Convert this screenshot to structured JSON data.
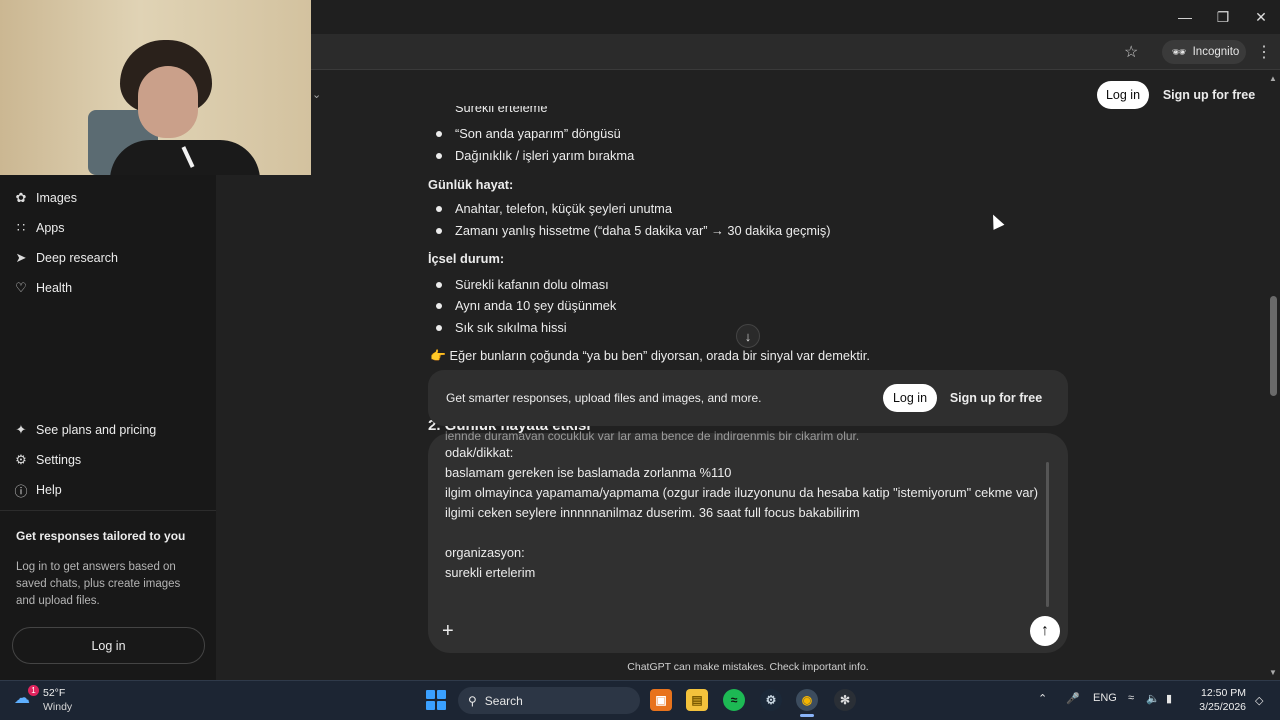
{
  "browser": {
    "incognito_label": "Incognito",
    "window_controls": [
      "minimize-icon",
      "restore-icon",
      "close-icon"
    ]
  },
  "header": {
    "login_label": "Log in",
    "signup_label": "Sign up for free"
  },
  "sidebar": {
    "items": [
      {
        "label": "Images",
        "icon": "images-icon"
      },
      {
        "label": "Apps",
        "icon": "apps-icon"
      },
      {
        "label": "Deep research",
        "icon": "telescope-icon"
      },
      {
        "label": "Health",
        "icon": "heart-icon"
      }
    ],
    "bottom_items": [
      {
        "label": "See plans and pricing",
        "icon": "plans-icon"
      },
      {
        "label": "Settings",
        "icon": "gear-icon"
      },
      {
        "label": "Help",
        "icon": "help-icon"
      }
    ],
    "promo_title": "Get responses tailored to you",
    "promo_text": "Log in to get answers based on saved chats, plus create images and upload files.",
    "login_label": "Log in"
  },
  "chat": {
    "cut_top_line": "Sürekli erteleme",
    "list1": [
      "“Son anda yaparım” döngüsü",
      "Dağınıklık / işleri yarım bırakma"
    ],
    "heading_daily": "Günlük hayat:",
    "list2": [
      "Anahtar, telefon, küçük şeyleri unutma",
      "Zamanı yanlış hissetme (“daha 5 dakika var” → 30 dakika geçmiş)"
    ],
    "heading_inner": "İçsel durum:",
    "list3": [
      "Sürekli kafanın dolu olması",
      "Aynı anda 10 şey düşünmek",
      "Sık sık sıkılma hissi"
    ],
    "conclusion": "👉 Eğer bunların çoğunda “ya bu ben” diyorsan, orada bir sinyal var demektir.",
    "section2": "2. Günlük hayata etkisi"
  },
  "banner": {
    "text": "Get smarter responses, upload files and images, and more.",
    "login_label": "Log in",
    "signup_label": "Sign up for free"
  },
  "composer": {
    "ghost_line": "iennde duramayan cocukluk var lar ama bence de indirgenmis bir cikarim olur.",
    "text": "odak/dikkat:\nbaslamam gereken ise baslamada zorlanma %110\nilgim olmayinca yapamama/yapmama (ozgur irade iluzyonunu da hesaba katip \"istemiyorum\" cekme var)\nilgimi ceken seylere innnnnanilmaz duserim. 36 saat full focus bakabilirim\n\norganizasyon:\nsurekli ertelerim",
    "disclaimer": "ChatGPT can make mistakes. Check important info."
  },
  "taskbar": {
    "weather_temp": "52°F",
    "weather_cond": "Windy",
    "weather_badge": "1",
    "search_label": "Search",
    "language": "ENG",
    "time": "12:50 PM",
    "date": "3/25/2026"
  },
  "colors": {
    "background": "#212121",
    "sidebar": "#181818",
    "composer": "#303030",
    "taskbar": "#1c2533",
    "accent_button": "#ffffff"
  }
}
